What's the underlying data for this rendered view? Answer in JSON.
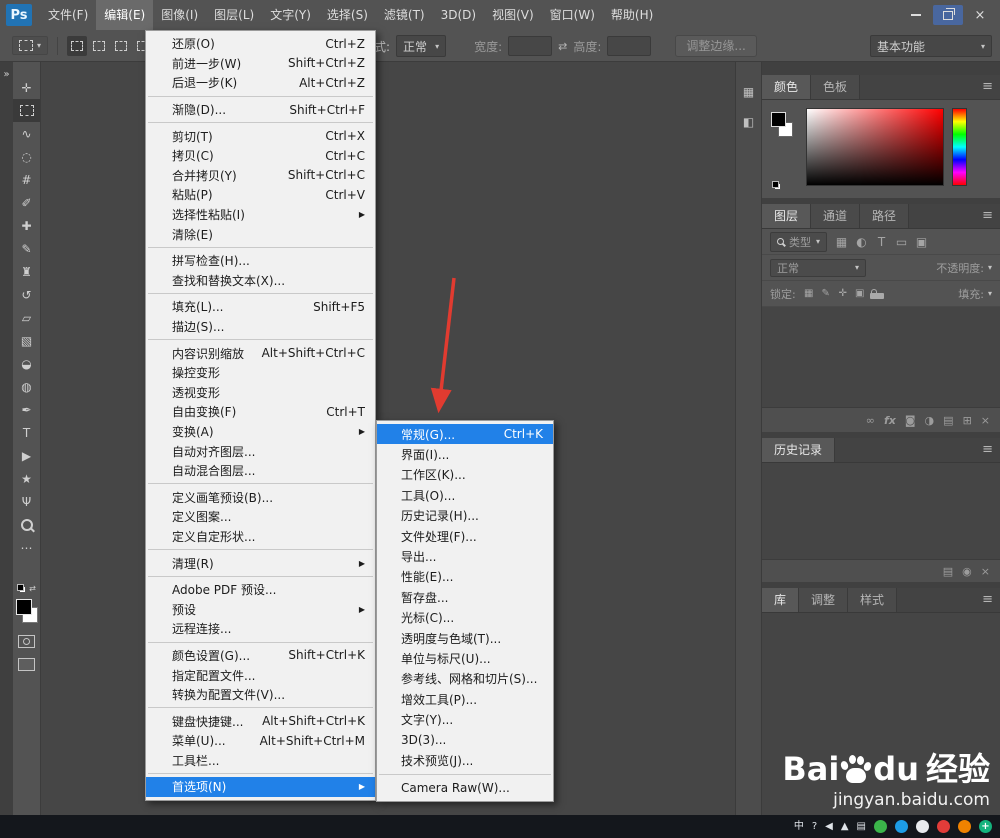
{
  "glyphs": {
    "caret": "▾",
    "panel_menu": "≡",
    "close": "×",
    "swap": "⇄",
    "submenu_arrow": "▶"
  },
  "colors": {
    "accent_blue": "#2181e8",
    "arrow_red": "#e13b30",
    "hue": "#ff0000"
  },
  "titlebar": {
    "logo_text": "Ps",
    "menus": [
      {
        "name": "menu-file",
        "label": "文件(F)"
      },
      {
        "name": "menu-edit",
        "label": "编辑(E)",
        "active": true
      },
      {
        "name": "menu-image",
        "label": "图像(I)"
      },
      {
        "name": "menu-layer",
        "label": "图层(L)"
      },
      {
        "name": "menu-type",
        "label": "文字(Y)"
      },
      {
        "name": "menu-select",
        "label": "选择(S)"
      },
      {
        "name": "menu-filter",
        "label": "滤镜(T)"
      },
      {
        "name": "menu-3d",
        "label": "3D(D)"
      },
      {
        "name": "menu-view",
        "label": "视图(V)"
      },
      {
        "name": "menu-window",
        "label": "窗口(W)"
      },
      {
        "name": "menu-help",
        "label": "帮助(H)"
      }
    ]
  },
  "options_bar": {
    "style_label": "样式:",
    "style_value": "正常",
    "width_label": "宽度:",
    "height_label": "高度:",
    "refine_edge_label": "调整边缘...",
    "workspace_label": "基本功能"
  },
  "toolbar": {
    "expand_glyph": "»",
    "tools": [
      {
        "name": "move-tool",
        "glyph": "✛"
      },
      {
        "name": "rectangular-marquee-tool",
        "kind": "marquee",
        "active": true
      },
      {
        "name": "lasso-tool",
        "glyph": "∿"
      },
      {
        "name": "quick-selection-tool",
        "glyph": "◌"
      },
      {
        "name": "crop-tool",
        "glyph": "#"
      },
      {
        "name": "eyedropper-tool",
        "glyph": "✐"
      },
      {
        "name": "spot-healing-brush-tool",
        "glyph": "✚"
      },
      {
        "name": "brush-tool",
        "glyph": "✎"
      },
      {
        "name": "clone-stamp-tool",
        "glyph": "♜"
      },
      {
        "name": "history-brush-tool",
        "glyph": "↺"
      },
      {
        "name": "eraser-tool",
        "glyph": "▱"
      },
      {
        "name": "gradient-tool",
        "glyph": "▧"
      },
      {
        "name": "blur-tool",
        "glyph": "◒"
      },
      {
        "name": "dodge-tool",
        "glyph": "◍"
      },
      {
        "name": "pen-tool",
        "glyph": "✒"
      },
      {
        "name": "type-tool",
        "glyph": "T"
      },
      {
        "name": "path-selection-tool",
        "glyph": "▶"
      },
      {
        "name": "custom-shape-tool",
        "glyph": "★"
      },
      {
        "name": "hand-tool",
        "glyph": "Ψ"
      },
      {
        "name": "zoom-tool",
        "kind": "zoom"
      },
      {
        "name": "edit-toolbar-button",
        "glyph": "⋯"
      }
    ]
  },
  "edit_menu": {
    "items": [
      {
        "label": "还原(O)",
        "shortcut": "Ctrl+Z"
      },
      {
        "label": "前进一步(W)",
        "shortcut": "Shift+Ctrl+Z"
      },
      {
        "label": "后退一步(K)",
        "shortcut": "Alt+Ctrl+Z"
      },
      {
        "separator": true
      },
      {
        "label": "渐隐(D)...",
        "shortcut": "Shift+Ctrl+F"
      },
      {
        "separator": true
      },
      {
        "label": "剪切(T)",
        "shortcut": "Ctrl+X"
      },
      {
        "label": "拷贝(C)",
        "shortcut": "Ctrl+C"
      },
      {
        "label": "合并拷贝(Y)",
        "shortcut": "Shift+Ctrl+C"
      },
      {
        "label": "粘贴(P)",
        "shortcut": "Ctrl+V"
      },
      {
        "label": "选择性粘贴(I)",
        "submenu": true
      },
      {
        "label": "清除(E)"
      },
      {
        "separator": true
      },
      {
        "label": "拼写检查(H)..."
      },
      {
        "label": "查找和替换文本(X)..."
      },
      {
        "separator": true
      },
      {
        "label": "填充(L)...",
        "shortcut": "Shift+F5"
      },
      {
        "label": "描边(S)..."
      },
      {
        "separator": true
      },
      {
        "label": "内容识别缩放",
        "shortcut": "Alt+Shift+Ctrl+C"
      },
      {
        "label": "操控变形"
      },
      {
        "label": "透视变形"
      },
      {
        "label": "自由变换(F)",
        "shortcut": "Ctrl+T"
      },
      {
        "label": "变换(A)",
        "submenu": true
      },
      {
        "label": "自动对齐图层..."
      },
      {
        "label": "自动混合图层..."
      },
      {
        "separator": true
      },
      {
        "label": "定义画笔预设(B)..."
      },
      {
        "label": "定义图案..."
      },
      {
        "label": "定义自定形状..."
      },
      {
        "separator": true
      },
      {
        "label": "清理(R)",
        "submenu": true
      },
      {
        "separator": true
      },
      {
        "label": "Adobe PDF 预设..."
      },
      {
        "label": "预设",
        "submenu": true
      },
      {
        "label": "远程连接..."
      },
      {
        "separator": true
      },
      {
        "label": "颜色设置(G)...",
        "shortcut": "Shift+Ctrl+K"
      },
      {
        "label": "指定配置文件..."
      },
      {
        "label": "转换为配置文件(V)..."
      },
      {
        "separator": true
      },
      {
        "label": "键盘快捷键...",
        "shortcut": "Alt+Shift+Ctrl+K"
      },
      {
        "label": "菜单(U)...",
        "shortcut": "Alt+Shift+Ctrl+M"
      },
      {
        "label": "工具栏..."
      },
      {
        "separator": true
      },
      {
        "label": "首选项(N)",
        "submenu": true,
        "highlighted": true
      }
    ]
  },
  "preferences_submenu": {
    "items": [
      {
        "label": "常规(G)...",
        "shortcut": "Ctrl+K",
        "highlighted": true
      },
      {
        "label": "界面(I)..."
      },
      {
        "label": "工作区(K)..."
      },
      {
        "label": "工具(O)..."
      },
      {
        "label": "历史记录(H)..."
      },
      {
        "label": "文件处理(F)..."
      },
      {
        "label": "导出..."
      },
      {
        "label": "性能(E)..."
      },
      {
        "label": "暂存盘..."
      },
      {
        "label": "光标(C)..."
      },
      {
        "label": "透明度与色域(T)..."
      },
      {
        "label": "单位与标尺(U)..."
      },
      {
        "label": "参考线、网格和切片(S)..."
      },
      {
        "label": "增效工具(P)..."
      },
      {
        "label": "文字(Y)..."
      },
      {
        "label": "3D(3)..."
      },
      {
        "label": "技术预览(J)..."
      },
      {
        "separator": true
      },
      {
        "label": "Camera Raw(W)..."
      }
    ]
  },
  "panels": {
    "dock_icons": [
      {
        "name": "dock-panel-icon-1",
        "glyph": "▦"
      },
      {
        "name": "dock-panel-icon-2",
        "glyph": "◧"
      }
    ],
    "color": {
      "tabs": [
        {
          "name": "tab-color",
          "label": "颜色",
          "active": true
        },
        {
          "name": "tab-swatches",
          "label": "色板"
        }
      ]
    },
    "layers": {
      "tabs": [
        {
          "name": "tab-layers",
          "label": "图层",
          "active": true
        },
        {
          "name": "tab-channels",
          "label": "通道"
        },
        {
          "name": "tab-paths",
          "label": "路径"
        }
      ],
      "filter_label": "类型",
      "filter_icons": [
        {
          "name": "filter-pixel-layers-icon",
          "glyph": "▦"
        },
        {
          "name": "filter-adjustment-layers-icon",
          "glyph": "◐"
        },
        {
          "name": "filter-type-layers-icon",
          "glyph": "T"
        },
        {
          "name": "filter-shape-layers-icon",
          "glyph": "▭"
        },
        {
          "name": "filter-smart-objects-icon",
          "glyph": "▣"
        }
      ],
      "blend_mode_value": "正常",
      "opacity_label": "不透明度:",
      "lock_label": "锁定:",
      "lock_icons": [
        {
          "name": "lock-transparent-pixels-icon",
          "glyph": "▦"
        },
        {
          "name": "lock-image-pixels-icon",
          "glyph": "✎"
        },
        {
          "name": "lock-position-icon",
          "glyph": "✛"
        },
        {
          "name": "lock-artboard-icon",
          "glyph": "▣"
        },
        {
          "name": "lock-all-icon",
          "kind": "lock"
        }
      ],
      "fill_label": "填充:",
      "bottom_icons": [
        {
          "name": "link-layers-icon",
          "glyph": "∞"
        },
        {
          "name": "layer-style-icon",
          "glyph": "fx"
        },
        {
          "name": "layer-mask-icon",
          "glyph": "◙"
        },
        {
          "name": "adjustment-layer-icon",
          "glyph": "◑"
        },
        {
          "name": "new-group-icon",
          "glyph": "▤"
        },
        {
          "name": "new-layer-icon",
          "glyph": "⊞"
        },
        {
          "name": "delete-layer-icon",
          "glyph": "×"
        }
      ]
    },
    "history": {
      "title": "历史记录",
      "bottom_icons": [
        {
          "name": "new-doc-from-state-icon",
          "glyph": "▤"
        },
        {
          "name": "new-snapshot-camera-icon",
          "glyph": "◉"
        },
        {
          "name": "delete-state-icon",
          "glyph": "×"
        }
      ]
    },
    "library": {
      "tabs": [
        {
          "name": "tab-libraries",
          "label": "库",
          "active": true
        },
        {
          "name": "tab-adjustments",
          "label": "调整"
        },
        {
          "name": "tab-styles",
          "label": "样式"
        }
      ]
    }
  },
  "watermark": {
    "brand_prefix": "Bai",
    "brand_suffix": "du",
    "brand_cn": "经验",
    "url": "jingyan.baidu.com"
  },
  "taskbar": {
    "tray": [
      {
        "name": "tray-ime-icon",
        "glyph": "中"
      },
      {
        "name": "tray-help-icon",
        "glyph": "?"
      },
      {
        "name": "tray-volume-icon",
        "glyph": "◀"
      },
      {
        "name": "tray-show-hidden-icon",
        "glyph": "▲"
      },
      {
        "name": "tray-document-icon",
        "glyph": "▤"
      },
      {
        "name": "tray-app-green-icon",
        "bg": "#3bb54a"
      },
      {
        "name": "tray-app-blue-icon",
        "bg": "#1d9ce5"
      },
      {
        "name": "tray-app-white-icon",
        "bg": "#e8eaed"
      },
      {
        "name": "tray-app-red-icon",
        "bg": "#e23c39"
      },
      {
        "name": "tray-app-orange-icon",
        "bg": "#f08200"
      },
      {
        "name": "tray-app-teal-icon",
        "bg": "#14b37d",
        "glyph": "+"
      }
    ]
  }
}
